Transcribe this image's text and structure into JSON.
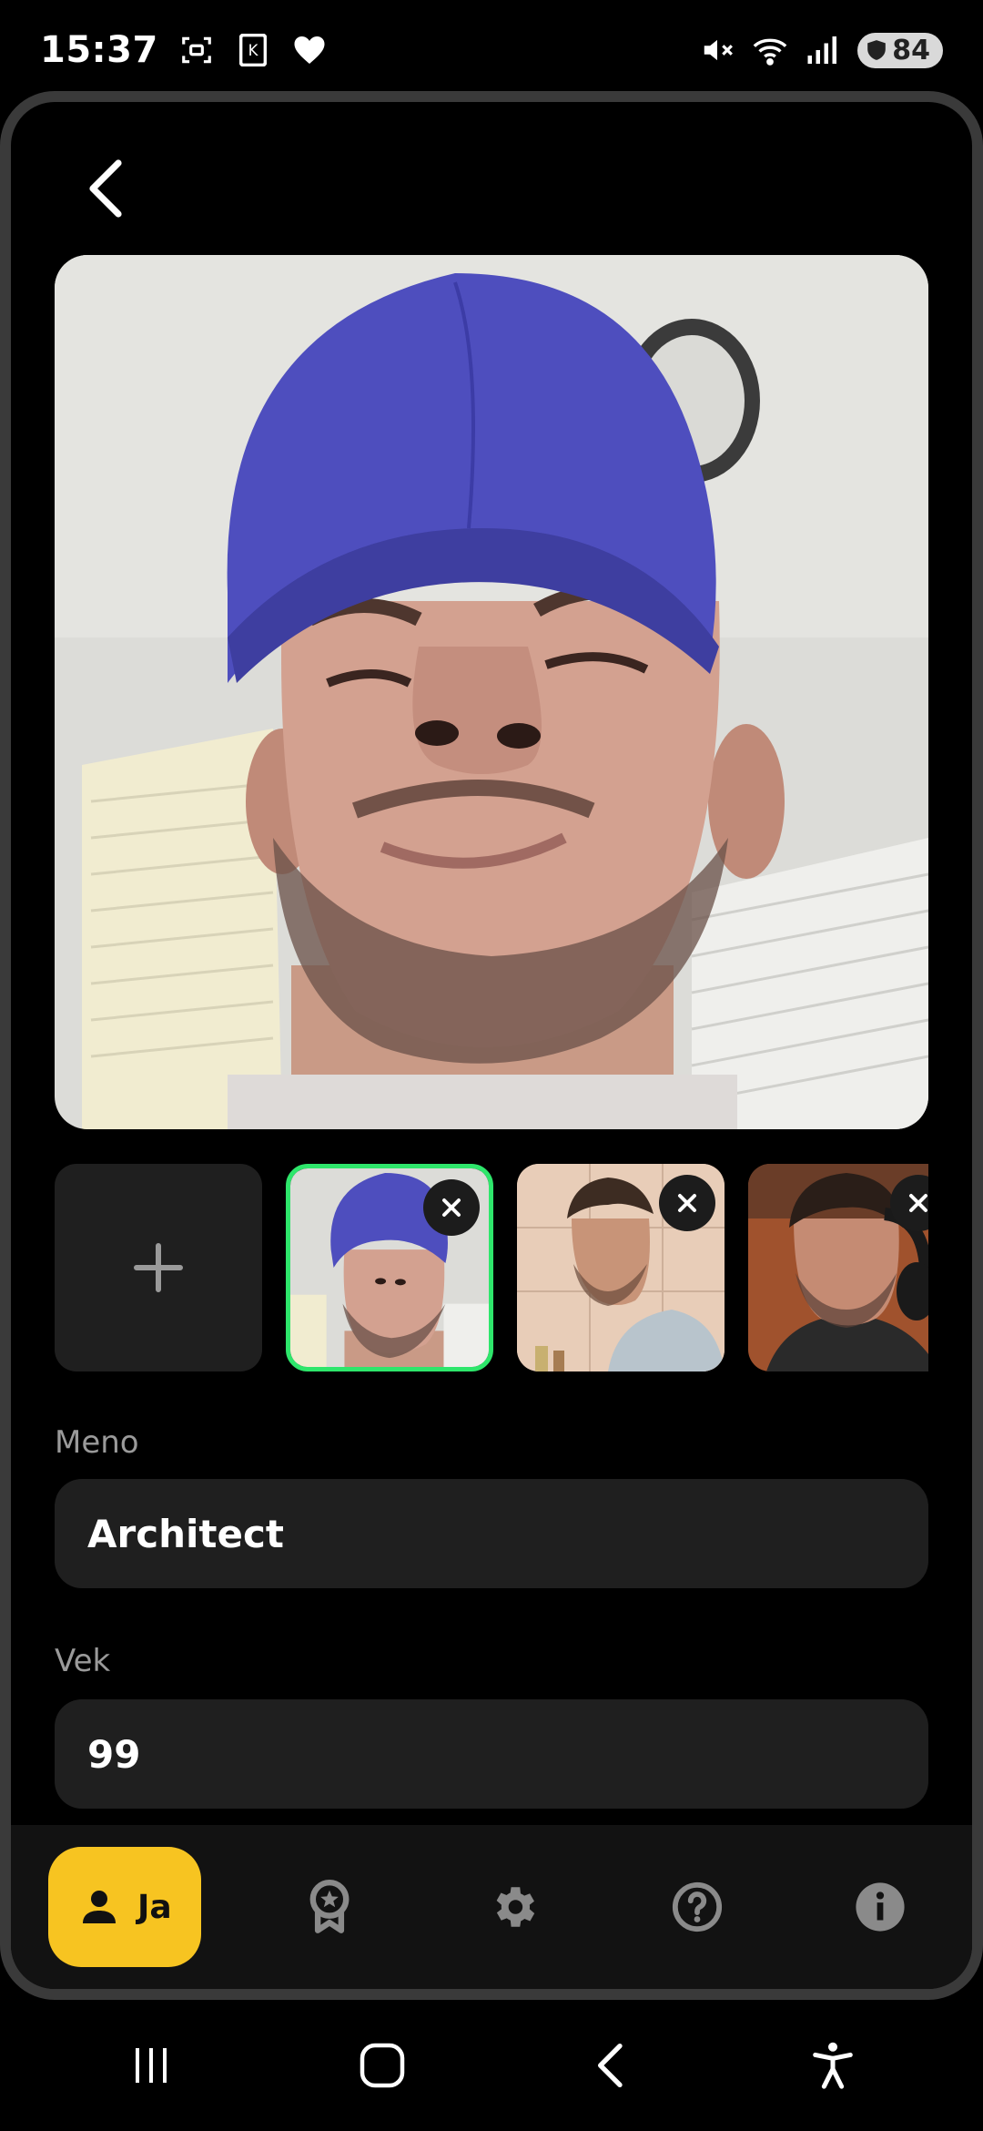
{
  "status_bar": {
    "time": "15:37",
    "battery": "84"
  },
  "profile": {
    "name_label": "Meno",
    "name_value": "Architect",
    "age_label": "Vek",
    "age_value": "99"
  },
  "bottom_nav": {
    "active_label": "Ja",
    "items": [
      "profile",
      "badges",
      "settings",
      "help",
      "info"
    ]
  },
  "colors": {
    "accent": "#f7c421",
    "selected_border": "#2ee66b",
    "field_bg": "#1f1f1f"
  }
}
